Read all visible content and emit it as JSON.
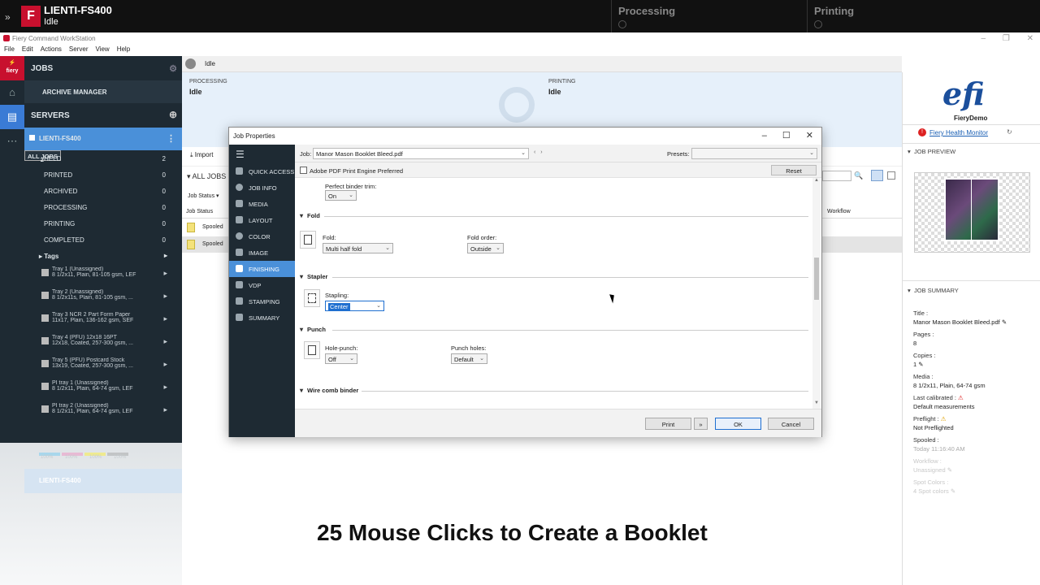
{
  "topbar": {
    "expand_icon": "double-chevron-right-icon",
    "server_name": "LIENTI-FS400",
    "server_status": "Idle",
    "processing_label": "Processing",
    "printing_label": "Printing"
  },
  "window": {
    "title": "Fiery Command WorkStation",
    "menu": [
      "File",
      "Edit",
      "Actions",
      "Server",
      "View",
      "Help"
    ]
  },
  "sidebar": {
    "jobs_label": "JOBS",
    "archive_label": "ARCHIVE MANAGER",
    "servers_label": "SERVERS",
    "server_item": "LIENTI-FS400",
    "queues": [
      {
        "label": "ALL JOBS",
        "count": "2"
      },
      {
        "label": "HELD",
        "count": "2"
      },
      {
        "label": "PRINTED",
        "count": "0"
      },
      {
        "label": "ARCHIVED",
        "count": "0"
      },
      {
        "label": "PROCESSING",
        "count": "0"
      },
      {
        "label": "PRINTING",
        "count": "0"
      },
      {
        "label": "COMPLETED",
        "count": "0"
      }
    ],
    "tags_label": "Tags",
    "trays": [
      {
        "name": "Tray 1 (Unassigned)",
        "desc": "8 1/2x11, Plain, 81-105 gsm, LEF"
      },
      {
        "name": "Tray 2 (Unassigned)",
        "desc": "8 1/2x11s, Plain, 81-105 gsm, ..."
      },
      {
        "name": "Tray 3 NCR 2 Part Form Paper",
        "desc": "11x17, Plain, 136-162 gsm, SEF"
      },
      {
        "name": "Tray 4 (PFU) 12x18 16PT",
        "desc": "12x18, Coated, 257-300 gsm, ..."
      },
      {
        "name": "Tray 5 (PFU) Postcard Stock",
        "desc": "13x19, Coated, 257-300 gsm, ..."
      },
      {
        "name": "PI tray 1 (Unassigned)",
        "desc": "8 1/2x11, Plain, 64-74 gsm, LEF"
      },
      {
        "name": "PI tray 2 (Unassigned)",
        "desc": "8 1/2x11, Plain, 64-74 gsm, LEF"
      }
    ],
    "toner_pct": "100%  100%  100%  100%",
    "toner_colors": [
      "#6fc9ef",
      "#ef8fc0",
      "#f5ec6a",
      "#444444"
    ],
    "faded_server": "LIENTI-FS400"
  },
  "main": {
    "status": "Idle",
    "processing_label": "PROCESSING",
    "processing_value": "Idle",
    "printing_label": "PRINTING",
    "printing_value": "Idle",
    "import_label": "Import",
    "all_jobs_heading": "ALL JOBS",
    "filter_label": "Job Status",
    "col_job_status": "Job Status",
    "col_workflow": "Workflow",
    "rows": [
      "Spooled",
      "Spooled"
    ]
  },
  "dialog": {
    "title": "Job Properties",
    "job_label": "Job:",
    "job_value": "Manor Mason Booklet Bleed.pdf",
    "presets_label": "Presets:",
    "presets_value": "",
    "pdf_engine_label": "Adobe PDF Print Engine Preferred",
    "reset_label": "Reset",
    "nav": [
      "QUICK ACCESS",
      "JOB INFO",
      "MEDIA",
      "LAYOUT",
      "COLOR",
      "IMAGE",
      "FINISHING",
      "VDP",
      "STAMPING",
      "SUMMARY"
    ],
    "nav_active": "FINISHING",
    "perfect_binder_trim_label": "Perfect binder trim:",
    "perfect_binder_trim_value": "On",
    "fold_section": "Fold",
    "fold_label": "Fold:",
    "fold_value": "Multi half fold",
    "fold_order_label": "Fold order:",
    "fold_order_value": "Outside",
    "stapler_section": "Stapler",
    "stapling_label": "Stapling:",
    "stapling_value": "Center",
    "punch_section": "Punch",
    "hole_punch_label": "Hole-punch:",
    "hole_punch_value": "Off",
    "punch_holes_label": "Punch holes:",
    "punch_holes_value": "Default",
    "wire_section": "Wire comb binder",
    "print_btn": "Print",
    "ok_btn": "OK",
    "cancel_btn": "Cancel"
  },
  "right": {
    "logo": "efi",
    "server_name": "FieryDemo",
    "health_link": "Fiery Health Monitor",
    "preview_heading": "JOB PREVIEW",
    "summary_heading": "JOB SUMMARY",
    "title_label": "Title :",
    "title_value": "Manor Mason Booklet Bleed.pdf",
    "pages_label": "Pages :",
    "pages_value": "8",
    "copies_label": "Copies :",
    "copies_value": "1",
    "media_label": "Media :",
    "media_value": "8 1/2x11, Plain, 64-74 gsm",
    "calibrated_label": "Last calibrated :",
    "calibrated_value": "Default measurements",
    "preflight_label": "Preflight :",
    "preflight_value": "Not Preflighted",
    "spooled_label": "Spooled :",
    "spooled_value": "Today 11:16:40 AM",
    "workflow_label": "Workflow :",
    "workflow_value": "Unassigned",
    "spot_label": "Spot Colors :",
    "spot_value": "4 Spot colors"
  },
  "caption": "25 Mouse Clicks to Create a Booklet"
}
